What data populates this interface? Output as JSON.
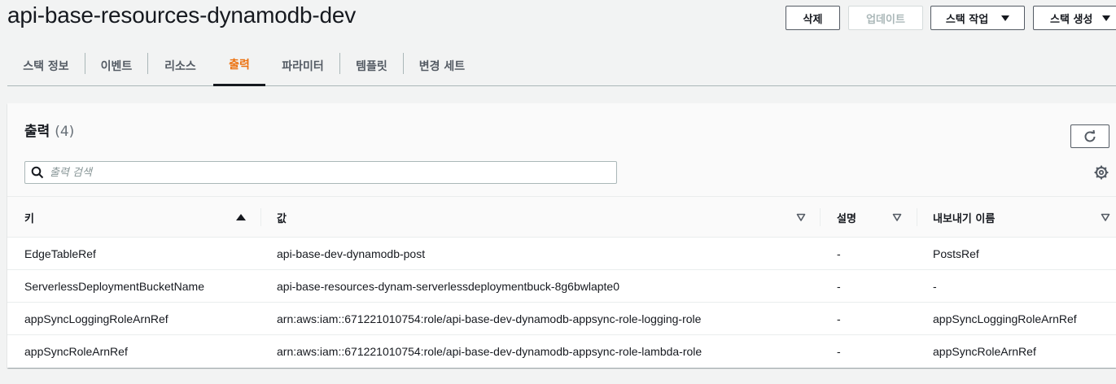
{
  "page": {
    "title": "api-base-resources-dynamodb-dev"
  },
  "actions": {
    "delete": "삭제",
    "update": "업데이트",
    "stack_actions": "스택 작업",
    "create_stack": "스택 생성"
  },
  "tabs": [
    {
      "label": "스택 정보",
      "active": false
    },
    {
      "label": "이벤트",
      "active": false
    },
    {
      "label": "리소스",
      "active": false
    },
    {
      "label": "출력",
      "active": true
    },
    {
      "label": "파라미터",
      "active": false
    },
    {
      "label": "템플릿",
      "active": false
    },
    {
      "label": "변경 세트",
      "active": false
    }
  ],
  "outputs": {
    "title": "출력",
    "count": "(4)",
    "search_placeholder": "출력 검색",
    "columns": [
      "키",
      "값",
      "설명",
      "내보내기 이름"
    ],
    "rows": [
      {
        "key": "EdgeTableRef",
        "value": "api-base-dev-dynamodb-post",
        "description": "-",
        "export": "PostsRef"
      },
      {
        "key": "ServerlessDeploymentBucketName",
        "value": "api-base-resources-dynam-serverlessdeploymentbuck-8g6bwlapte0",
        "description": "-",
        "export": "-"
      },
      {
        "key": "appSyncLoggingRoleArnRef",
        "value": "arn:aws:iam::671221010754:role/api-base-dev-dynamodb-appsync-role-logging-role",
        "description": "-",
        "export": "appSyncLoggingRoleArnRef"
      },
      {
        "key": "appSyncRoleArnRef",
        "value": "arn:aws:iam::671221010754:role/api-base-dev-dynamodb-appsync-role-lambda-role",
        "description": "-",
        "export": "appSyncRoleArnRef"
      }
    ]
  },
  "colors": {
    "accent": "#ec7211",
    "text": "#16191f",
    "muted": "#545b64"
  },
  "icons": {
    "refresh": "refresh-icon",
    "search": "search-icon",
    "settings": "gear-icon",
    "sort_asc": "sort-ascending-icon",
    "sort": "sort-icon",
    "caret": "caret-down-icon"
  }
}
